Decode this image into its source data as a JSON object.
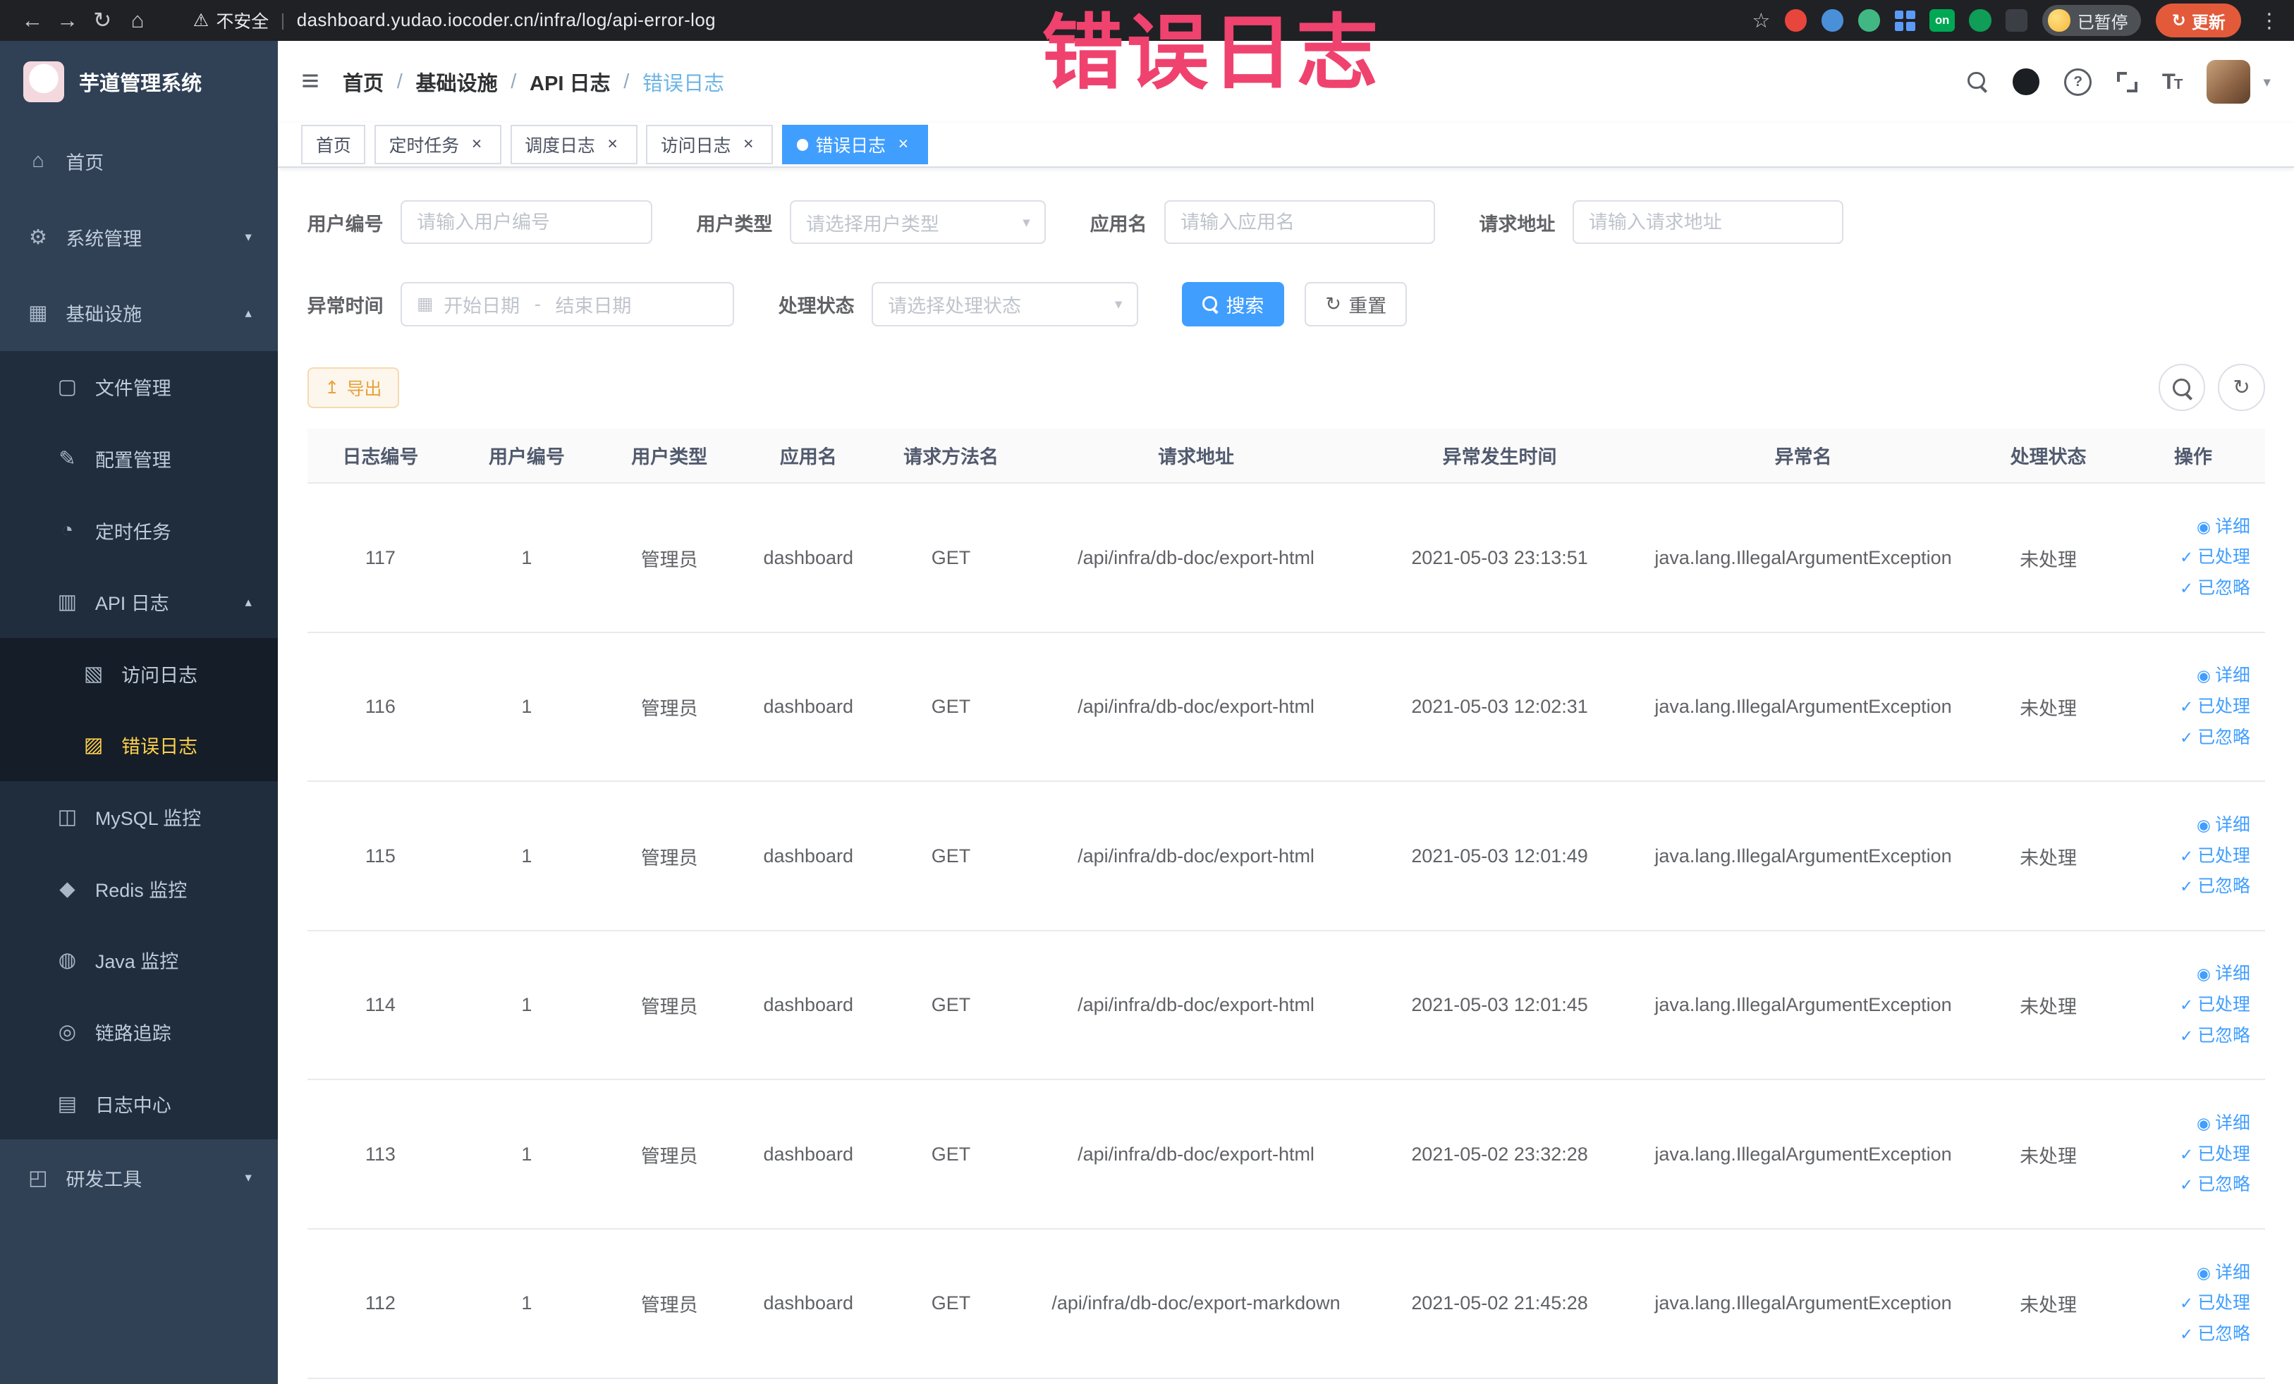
{
  "annotation": {
    "text": "错误日志",
    "color": "#f0426e"
  },
  "theme": {
    "primary": "#409eff",
    "sidebar_active": "#ffd04b",
    "warning": "#e6a23c"
  },
  "icons": {
    "back": "←",
    "forward": "→",
    "reload": "↻",
    "home": "⌂",
    "warning": "⚠",
    "star": "☆",
    "kebab": "⋮",
    "hamburger": "≡",
    "caret_down": "▾",
    "chevron_down": "▾",
    "calendar": "▦",
    "export": "↥",
    "refresh": "↻",
    "dot": "●",
    "close": "×",
    "eye": "◉",
    "check": "✓",
    "divider": "|",
    "question": "?"
  },
  "browser": {
    "security_label": "不安全",
    "url": "dashboard.yudao.iocoder.cn/infra/log/api-error-log",
    "extension_on_badge": "on",
    "paused_label": "已暂停",
    "update_label": "更新"
  },
  "sidebar": {
    "title": "芋道管理系统",
    "items": [
      {
        "label": "首页",
        "icon": "⌂"
      },
      {
        "label": "系统管理",
        "icon": "⚙",
        "arrow": "▾"
      },
      {
        "label": "基础设施",
        "icon": "▦",
        "arrow": "▴"
      },
      {
        "label": "文件管理",
        "icon": "▢"
      },
      {
        "label": "配置管理",
        "icon": "✎"
      },
      {
        "label": "定时任务",
        "icon": "◔"
      },
      {
        "label": "API 日志",
        "icon": "▥",
        "arrow": "▴"
      },
      {
        "label": "访问日志",
        "icon": "▧"
      },
      {
        "label": "错误日志",
        "icon": "▨"
      },
      {
        "label": "MySQL 监控",
        "icon": "◫"
      },
      {
        "label": "Redis 监控",
        "icon": "◆"
      },
      {
        "label": "Java 监控",
        "icon": "◍"
      },
      {
        "label": "链路追踪",
        "icon": "◎"
      },
      {
        "label": "日志中心",
        "icon": "▤"
      },
      {
        "label": "研发工具",
        "icon": "◰",
        "arrow": "▾"
      }
    ]
  },
  "breadcrumb": {
    "items": [
      "首页",
      "基础设施",
      "API 日志",
      "错误日志"
    ],
    "separator": "/"
  },
  "tabs": [
    {
      "label": "首页"
    },
    {
      "label": "定时任务"
    },
    {
      "label": "调度日志"
    },
    {
      "label": "访问日志"
    },
    {
      "label": "错误日志"
    }
  ],
  "filters": {
    "user_id_label": "用户编号",
    "user_id_placeholder": "请输入用户编号",
    "user_type_label": "用户类型",
    "user_type_placeholder": "请选择用户类型",
    "app_name_label": "应用名",
    "app_name_placeholder": "请输入应用名",
    "request_url_label": "请求地址",
    "request_url_placeholder": "请输入请求地址",
    "exception_time_label": "异常时间",
    "date_start_placeholder": "开始日期",
    "date_separator": "-",
    "date_end_placeholder": "结束日期",
    "process_status_label": "处理状态",
    "process_status_placeholder": "请选择处理状态",
    "search_button": "搜索",
    "reset_button": "重置"
  },
  "toolbar": {
    "export_button": "导出"
  },
  "table": {
    "columns": [
      "日志编号",
      "用户编号",
      "用户类型",
      "应用名",
      "请求方法名",
      "请求地址",
      "异常发生时间",
      "异常名",
      "处理状态",
      "操作"
    ],
    "actions": {
      "detail": "详细",
      "processed": "已处理",
      "ignored": "已忽略"
    },
    "rows": [
      {
        "log_id": "117",
        "user_id": "1",
        "user_type": "管理员",
        "app_name": "dashboard",
        "method": "GET",
        "url": "/api/infra/db-doc/export-html",
        "time": "2021-05-03 23:13:51",
        "exception": "java.lang.IllegalArgumentException",
        "status": "未处理"
      },
      {
        "log_id": "116",
        "user_id": "1",
        "user_type": "管理员",
        "app_name": "dashboard",
        "method": "GET",
        "url": "/api/infra/db-doc/export-html",
        "time": "2021-05-03 12:02:31",
        "exception": "java.lang.IllegalArgumentException",
        "status": "未处理"
      },
      {
        "log_id": "115",
        "user_id": "1",
        "user_type": "管理员",
        "app_name": "dashboard",
        "method": "GET",
        "url": "/api/infra/db-doc/export-html",
        "time": "2021-05-03 12:01:49",
        "exception": "java.lang.IllegalArgumentException",
        "status": "未处理"
      },
      {
        "log_id": "114",
        "user_id": "1",
        "user_type": "管理员",
        "app_name": "dashboard",
        "method": "GET",
        "url": "/api/infra/db-doc/export-html",
        "time": "2021-05-03 12:01:45",
        "exception": "java.lang.IllegalArgumentException",
        "status": "未处理"
      },
      {
        "log_id": "113",
        "user_id": "1",
        "user_type": "管理员",
        "app_name": "dashboard",
        "method": "GET",
        "url": "/api/infra/db-doc/export-html",
        "time": "2021-05-02 23:32:28",
        "exception": "java.lang.IllegalArgumentException",
        "status": "未处理"
      },
      {
        "log_id": "112",
        "user_id": "1",
        "user_type": "管理员",
        "app_name": "dashboard",
        "method": "GET",
        "url": "/api/infra/db-doc/export-markdown",
        "time": "2021-05-02 21:45:28",
        "exception": "java.lang.IllegalArgumentException",
        "status": "未处理"
      }
    ]
  }
}
